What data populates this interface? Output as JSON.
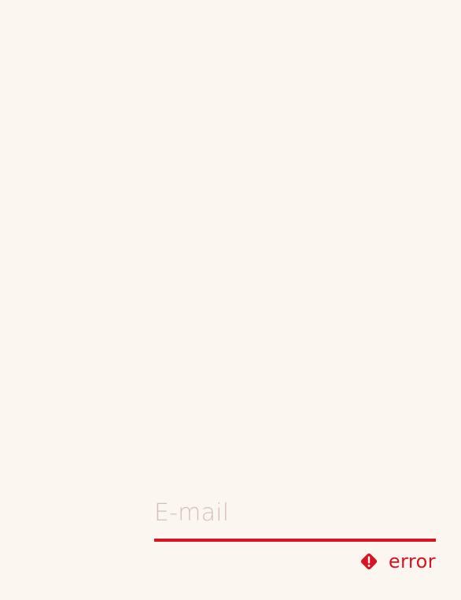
{
  "email_field": {
    "placeholder": "E-mail",
    "value": ""
  },
  "error": {
    "label": "error",
    "icon": "error-diamond-icon"
  },
  "colors": {
    "background": "#fcf6f1",
    "error_accent": "#d91322",
    "placeholder": "#d6bdbd"
  }
}
